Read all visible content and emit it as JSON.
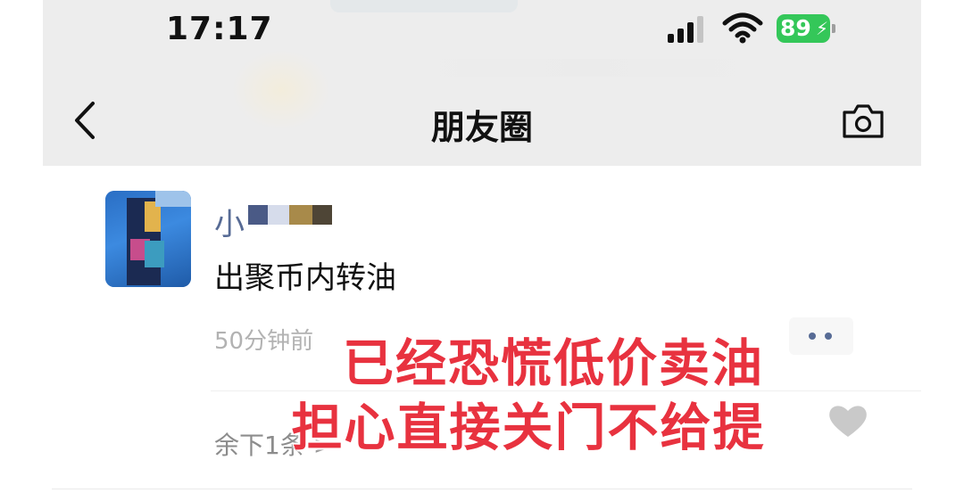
{
  "status_bar": {
    "time": "17:17",
    "battery": "89",
    "battery_color": "#34c759"
  },
  "nav": {
    "title": "朋友圈",
    "back_icon": "chevron-left-icon",
    "camera_icon": "camera-icon"
  },
  "post": {
    "username_visible": "小",
    "username_obscured": true,
    "content": "出聚币内转油",
    "time_ago": "50分钟前",
    "more_icon": "ellipsis-icon",
    "remaining_comments": "余下1条 >"
  },
  "overlay_caption": {
    "line1": "已经恐慌低价卖油",
    "line2": "担心直接关门不给提",
    "color": "#e8323f"
  },
  "colors": {
    "link_blue": "#576b95",
    "nav_bg": "#ededed"
  }
}
